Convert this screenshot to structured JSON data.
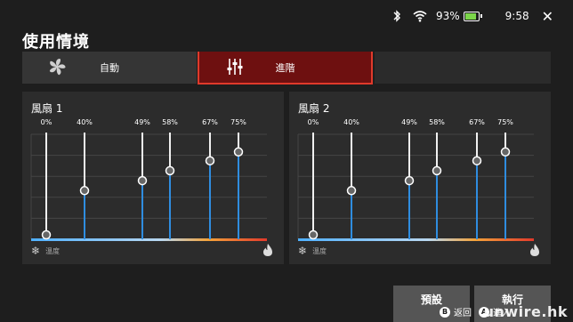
{
  "statusbar": {
    "battery": "93%",
    "time": "9:58"
  },
  "header": {
    "title": "使用情境"
  },
  "tabs": [
    {
      "label": "自動",
      "icon": "fan-icon",
      "active": false
    },
    {
      "label": "進階",
      "icon": "equalizer-icon",
      "active": true
    }
  ],
  "panels": [
    {
      "title": "風扇 1",
      "temp_label": "溫度",
      "points": [
        0,
        40,
        49,
        58,
        67,
        75
      ],
      "point_labels": [
        "0%",
        "40%",
        "49%",
        "58%",
        "67%",
        "75%"
      ]
    },
    {
      "title": "風扇 2",
      "temp_label": "溫度",
      "points": [
        0,
        40,
        49,
        58,
        67,
        75
      ],
      "point_labels": [
        "0%",
        "40%",
        "49%",
        "58%",
        "67%",
        "75%"
      ]
    }
  ],
  "buttons": {
    "default": "預設",
    "run": "執行"
  },
  "hints": {
    "back": "返回",
    "enter": "進入",
    "back_key": "B",
    "enter_key": "A"
  },
  "watermark": "unwire.hk",
  "colors": {
    "accent_red": "#e03a2b",
    "active_tab": "#6e1010",
    "slider_blue": "#2f8de0"
  }
}
